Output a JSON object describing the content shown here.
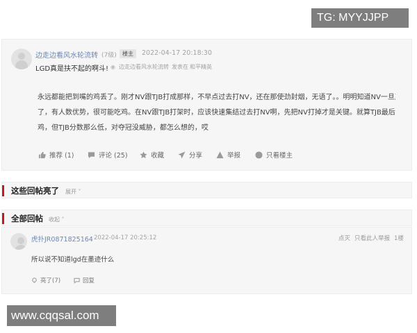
{
  "watermarks": {
    "telegram": "TG: MYYJJPP",
    "site": "www.cqqsal.com"
  },
  "post": {
    "author": "边走边看风水轮流转",
    "level": "(7级)",
    "badge": "楼主",
    "timestamp": "2022-04-17 20:18:30",
    "title": "LGD真是扶不起的啊斗!",
    "sub_author": "边走边看风水轮流转",
    "sub_action": "发表在",
    "sub_board": "和平精英",
    "body_lines": [
      "永远都能把到嘴的鸡丢了。刚才NV跟TJB打成那样，不早点过去打NV，还在那使劲封烟，无语了。。明明知道NV一旦赢",
      "了，有人数优势，很可能吃鸡。在NV跟TJB打架时，应该快速集结过去打NV啊，先把NV打掉才是关键。就算TJB最后吃",
      "鸡，但TJB分数那么低，对夺冠没威胁，都怎么想的，哎"
    ],
    "actions": {
      "recommend": "推荐 (1)",
      "comment": "评论 (25)",
      "favorite": "收藏",
      "share": "分享",
      "report": "举报",
      "only_op": "只看楼主"
    }
  },
  "sections": {
    "hot_replies": {
      "title": "这些回帖亮了",
      "toggle": "展开"
    },
    "all_replies": {
      "title": "全部回帖",
      "toggle": "收起"
    }
  },
  "reply": {
    "author": "虎扑JR0871825164",
    "timestamp": "2022-04-17 20:25:12",
    "text": "所以说不知道lgd在墨迹什么",
    "like": "亮了(7)",
    "reply_label": "回复",
    "meta": {
      "dislike": "点灭",
      "only_this": "只看此人",
      "report": "举报",
      "floor": "1楼"
    }
  }
}
